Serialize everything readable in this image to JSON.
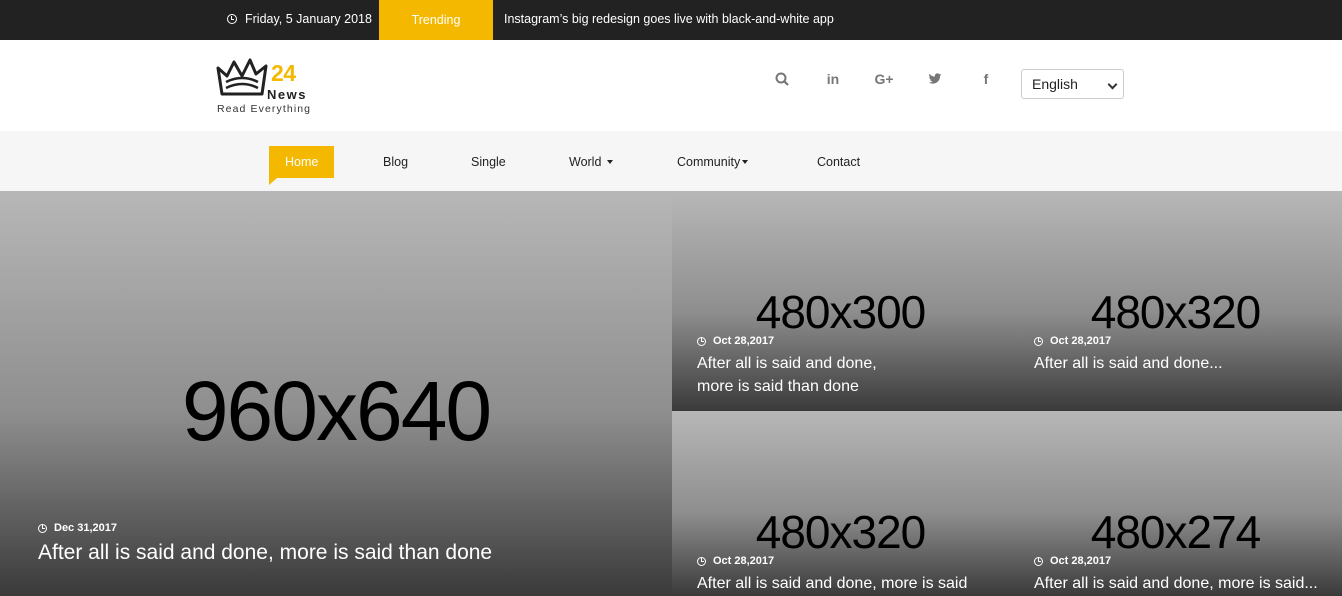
{
  "topbar": {
    "date": "Friday, 5 January 2018",
    "trending_label": "Trending",
    "headline": "Instagram’s big redesign goes live with black-and-white app"
  },
  "logo": {
    "number": "24",
    "word": "News",
    "tagline": "Read Everything"
  },
  "social": [
    {
      "icon": "search-icon",
      "glyph": "⌕"
    },
    {
      "icon": "linkedin-icon",
      "glyph": "in"
    },
    {
      "icon": "google-plus-icon",
      "glyph": "G+"
    },
    {
      "icon": "twitter-icon",
      "glyph": "🐦"
    },
    {
      "icon": "facebook-icon",
      "glyph": "f"
    }
  ],
  "language": {
    "selected": "English"
  },
  "nav": {
    "home": "Home",
    "blog": "Blog",
    "single": "Single",
    "world": "World",
    "community": "Community",
    "contact": "Contact"
  },
  "colors": {
    "accent": "#f5b800",
    "topbar": "#222222",
    "nav_bg": "#f6f6f6"
  },
  "featured": {
    "main": {
      "placeholder": "960x640",
      "date": "Dec 31,2017",
      "title": "After all is said and done, more is said than done"
    },
    "tile1": {
      "placeholder": "480x300",
      "date": "Oct 28,2017",
      "title_line1": "After all is said and done,",
      "title_line2": "more is said than done"
    },
    "tile2": {
      "placeholder": "480x320",
      "date": "Oct 28,2017",
      "title": "After all is said and done..."
    },
    "tile3": {
      "placeholder": "480x320",
      "date": "Oct 28,2017",
      "title": "After all is said and done, more is said"
    },
    "tile4": {
      "placeholder": "480x274",
      "date": "Oct 28,2017",
      "title": "After all is said and done, more is said..."
    }
  }
}
